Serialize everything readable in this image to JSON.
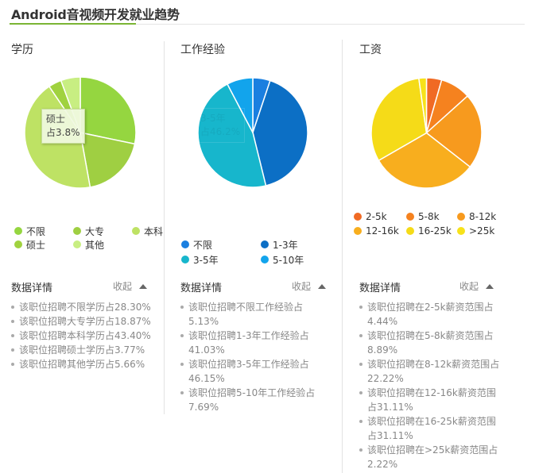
{
  "page": {
    "title": "Android音视频开发就业趋势",
    "collapse_label": "收起",
    "details_label": "数据详情"
  },
  "chart_data": [
    {
      "type": "pie",
      "title": "学历",
      "categories": [
        "不限",
        "大专",
        "本科",
        "硕士",
        "其他"
      ],
      "values": [
        28.3,
        18.87,
        43.4,
        3.77,
        5.66
      ],
      "colors": [
        "#95d640",
        "#9fcf42",
        "#bee264",
        "#a0d23f",
        "#c8ee82"
      ],
      "tooltip": {
        "label": "硕士",
        "value": "占3.8%"
      },
      "details": [
        {
          "text": "该职位招聘不限学历占",
          "value": "28.30%"
        },
        {
          "text": "该职位招聘大专学历占",
          "value": "18.87%"
        },
        {
          "text": "该职位招聘本科学历占",
          "value": "43.40%"
        },
        {
          "text": "该职位招聘硕士学历占",
          "value": "3.77%"
        },
        {
          "text": "该职位招聘其他学历占",
          "value": "5.66%"
        }
      ]
    },
    {
      "type": "pie",
      "title": "工作经验",
      "categories": [
        "不限",
        "1-3年",
        "3-5年",
        "5-10年"
      ],
      "values": [
        5.13,
        41.03,
        46.15,
        7.69
      ],
      "colors": [
        "#1a7fe0",
        "#0c6fc5",
        "#17b6cc",
        "#12a4ec"
      ],
      "ghost_tooltip": {
        "label": "3-5年",
        "value": "占46.2%"
      },
      "details": [
        {
          "text": "该职位招聘不限工作经验占",
          "value": "5.13%"
        },
        {
          "text": "该职位招聘1-3年工作经验占",
          "value": "41.03%"
        },
        {
          "text": "该职位招聘3-5年工作经验占",
          "value": "46.15%"
        },
        {
          "text": "该职位招聘5-10年工作经验占",
          "value": "7.69%"
        }
      ]
    },
    {
      "type": "pie",
      "title": "工资",
      "categories": [
        "2-5k",
        "5-8k",
        "8-12k",
        "12-16k",
        "16-25k",
        ">25k"
      ],
      "values": [
        4.44,
        8.89,
        22.22,
        31.11,
        31.11,
        2.22
      ],
      "colors": [
        "#f06a24",
        "#f5821f",
        "#f79a1e",
        "#f8ae1e",
        "#f5db18",
        "#f7e21a"
      ],
      "details": [
        {
          "text": "该职位招聘在2-5k薪资范围占",
          "value": "4.44%"
        },
        {
          "text": "该职位招聘在5-8k薪资范围占",
          "value": "8.89%"
        },
        {
          "text": "该职位招聘在8-12k薪资范围",
          "value": "占22.22%"
        },
        {
          "text": "该职位招聘在12-16k薪资范围",
          "value": "占31.11%"
        },
        {
          "text": "该职位招聘在16-25k薪资范围",
          "value": "占31.11%"
        },
        {
          "text": "该职位招聘在>25k薪资范围占",
          "value": "2.22%"
        }
      ]
    }
  ]
}
